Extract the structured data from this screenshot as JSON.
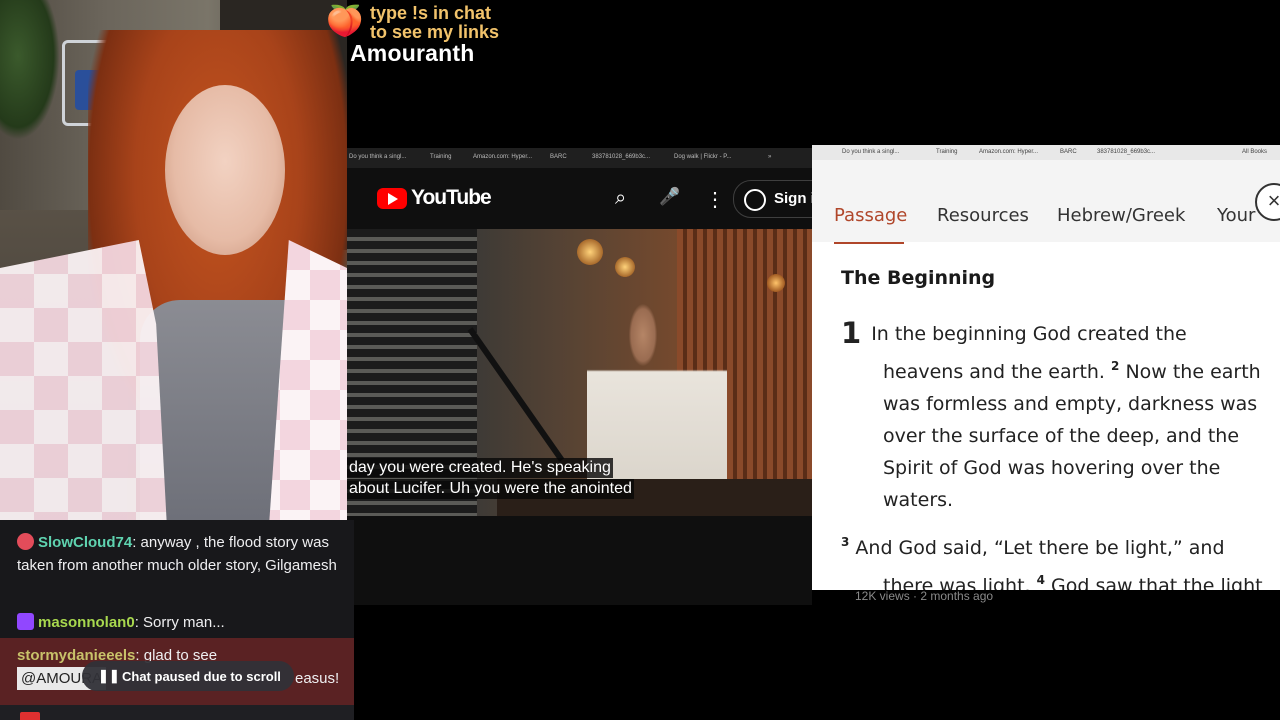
{
  "overlay": {
    "peach_icon": "🍑",
    "promo_line1": "type !s in chat",
    "promo_line2": "to see my links",
    "streamer": "Amouranth"
  },
  "youtube": {
    "bookmarks": [
      "Do you think a singl...",
      "Training",
      "Amazon.com: Hyper...",
      "BARC",
      "383781028_669b3c...",
      "Dog walk | Flickr - P...",
      "»"
    ],
    "brand": "YouTube",
    "signin_label": "Sign in",
    "captions": [
      "day you were created. He's speaking",
      "about Lucifer. Uh you were the anointed"
    ],
    "meta": "12K views · 2 months ago",
    "icons": {
      "search": "⌕",
      "mic": "🎤",
      "more": "⋮"
    }
  },
  "bible": {
    "bookmarks": [
      "Do you think a singl...",
      "Training",
      "Amazon.com: Hyper...",
      "BARC",
      "383781028_669b3c...",
      "All Books"
    ],
    "tabs": [
      "Passage",
      "Resources",
      "Hebrew/Greek",
      "Your"
    ],
    "active_tab": "Passage",
    "heading": "The Beginning",
    "chapter": "1",
    "v1": "In the beginning God created the heavens and the earth.",
    "v2_num": "2",
    "v2": "Now the earth was formless and empty, darkness was over the surface of the deep, and the Spirit of God was hovering over the waters.",
    "v3_num": "3",
    "v3": "And God said, “Let there be light,” and there was light.",
    "v4_num": "4",
    "v4": "God saw that the light was good, and he separated the light from"
  },
  "chat": {
    "messages": [
      {
        "user": "SlowCloud74",
        "text": ": anyway , the flood story was taken from another much older story, Gilgamesh",
        "color": "#5fd3b0"
      },
      {
        "user": "masonnolan0",
        "text": ": Sorry man...",
        "color": "#a8d84e"
      },
      {
        "user": "stormydanieeels",
        "text": ": glad to see",
        "color": "#c8c26a"
      }
    ],
    "mention": "@AMOURA",
    "mention_tail": "easus!",
    "paused_icon": "❚❚",
    "paused": "Chat paused due to scroll"
  },
  "colors": {
    "accent_passage": "#b0462a",
    "youtube_red": "#ff0000",
    "chat_bg": "#18181b"
  }
}
